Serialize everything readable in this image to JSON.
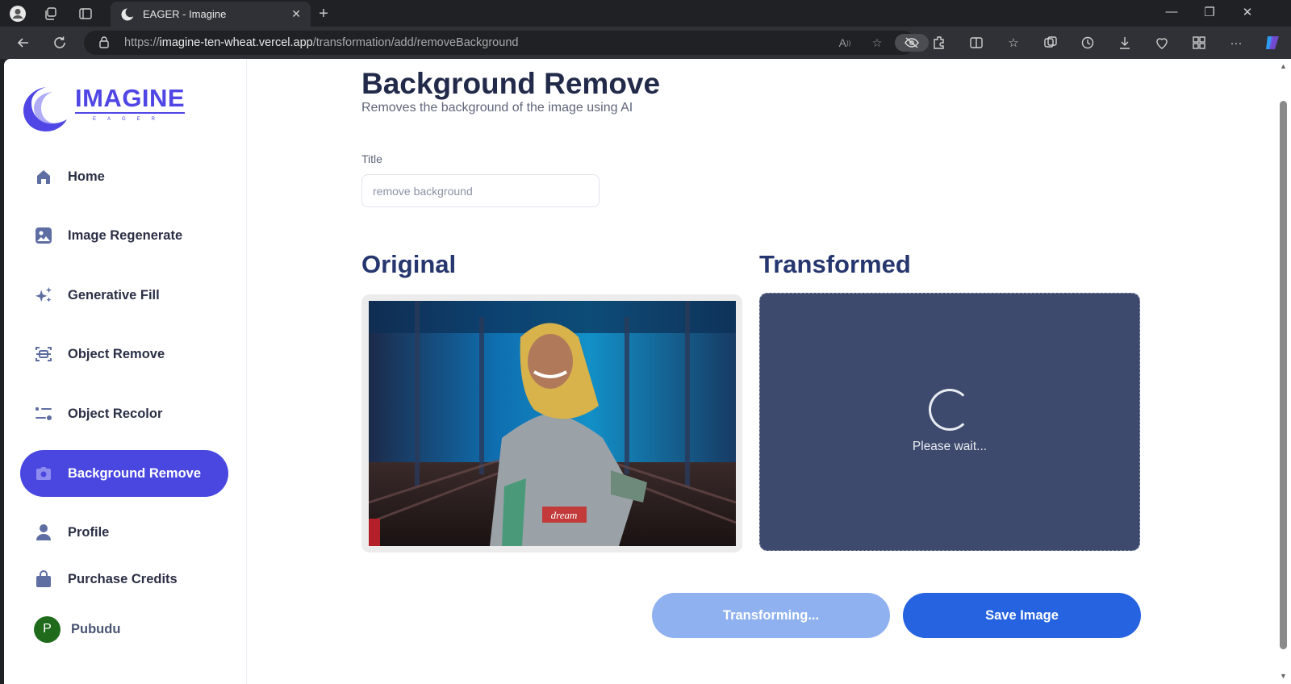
{
  "browser": {
    "tab_title": "EAGER - Imagine",
    "url_prefix": "https://",
    "url_host": "imagine-ten-wheat.vercel.app",
    "url_path": "/transformation/add/removeBackground"
  },
  "sidebar": {
    "logo_text": "IMAGINE",
    "logo_sub": "EAGER",
    "items": [
      {
        "label": "Home",
        "icon": "home-icon"
      },
      {
        "label": "Image Regenerate",
        "icon": "image-icon"
      },
      {
        "label": "Generative Fill",
        "icon": "sparkles-icon"
      },
      {
        "label": "Object Remove",
        "icon": "scan-icon"
      },
      {
        "label": "Object Recolor",
        "icon": "filter-icon"
      },
      {
        "label": "Background Remove",
        "icon": "camera-icon",
        "active": true
      },
      {
        "label": "Profile",
        "icon": "user-icon"
      },
      {
        "label": "Purchase Credits",
        "icon": "bag-icon"
      }
    ],
    "user": {
      "initial": "P",
      "name": "Pubudu"
    }
  },
  "main": {
    "title": "Background Remove",
    "subtitle": "Removes the background of the image using AI",
    "title_label": "Title",
    "title_value": "remove background",
    "original_heading": "Original",
    "transformed_heading": "Transformed",
    "wait_text": "Please wait...",
    "transform_button": "Transforming...",
    "save_button": "Save Image"
  },
  "colors": {
    "accent": "#4a47e0",
    "save": "#2563e0",
    "transforming": "#8fb1ef",
    "transformed_bg": "#3e4a6d",
    "heading": "#26366e"
  }
}
